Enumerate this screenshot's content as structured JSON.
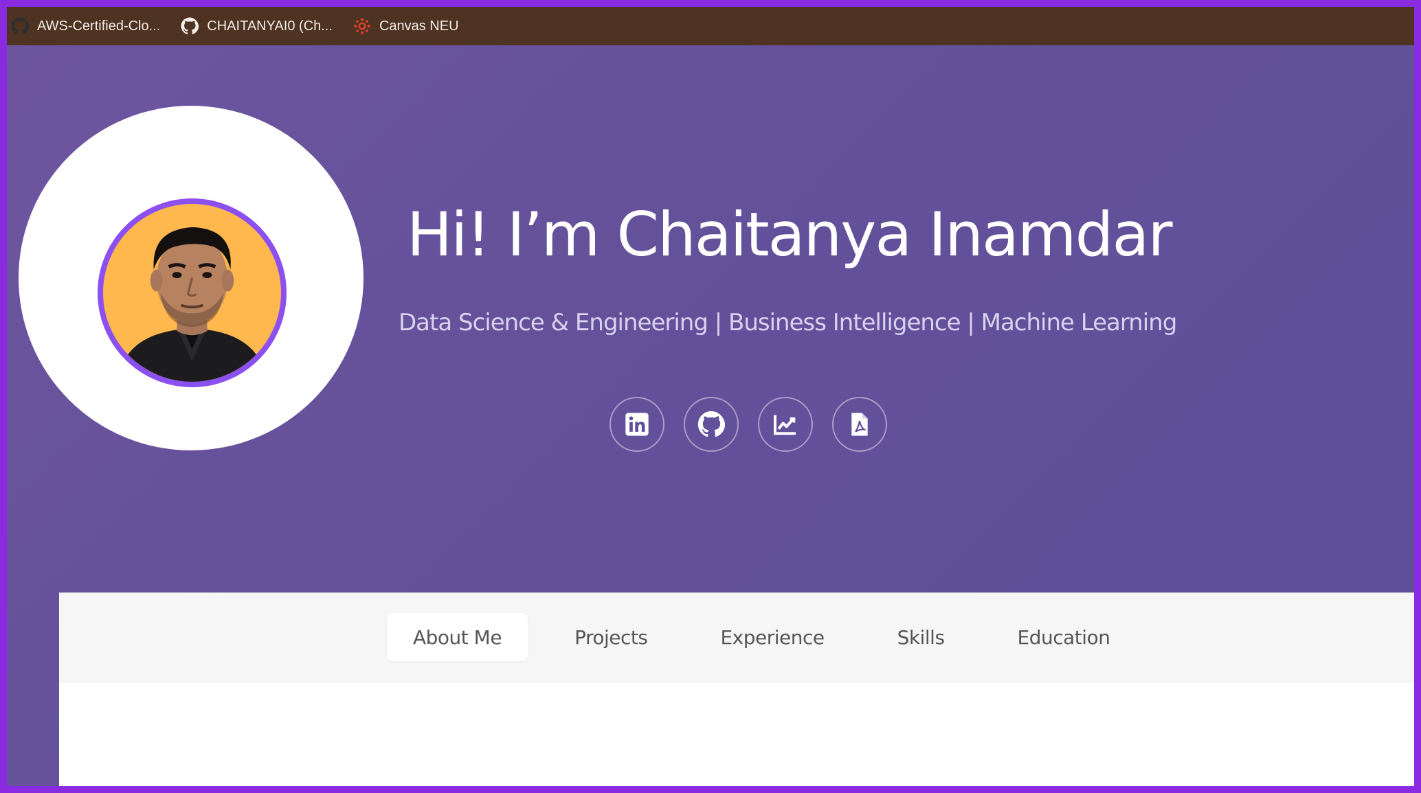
{
  "bookmarks": [
    {
      "label": "AWS-Certified-Clo...",
      "icon": "github-icon"
    },
    {
      "label": "CHAITANYAI0 (Ch...",
      "icon": "github-icon"
    },
    {
      "label": "Canvas NEU",
      "icon": "canvas-icon"
    }
  ],
  "hero": {
    "title": "Hi! I’m Chaitanya Inamdar",
    "subtitle": "Data Science & Engineering | Business Intelligence | Machine Learning",
    "social": [
      {
        "icon": "linkedin-icon"
      },
      {
        "icon": "github-icon"
      },
      {
        "icon": "chart-icon"
      },
      {
        "icon": "pdf-icon"
      }
    ]
  },
  "tabs": [
    {
      "label": "About Me",
      "active": true
    },
    {
      "label": "Projects",
      "active": false
    },
    {
      "label": "Experience",
      "active": false
    },
    {
      "label": "Skills",
      "active": false
    },
    {
      "label": "Education",
      "active": false
    }
  ],
  "colors": {
    "bookmarks_bar": "#4e3322",
    "hero_gradient_start": "#6f55a0",
    "hero_gradient_end": "#5e4e9a",
    "avatar_ring": "#8c4ff0",
    "avatar_bg": "#ffb84d",
    "canvas_red": "#e0402b"
  }
}
